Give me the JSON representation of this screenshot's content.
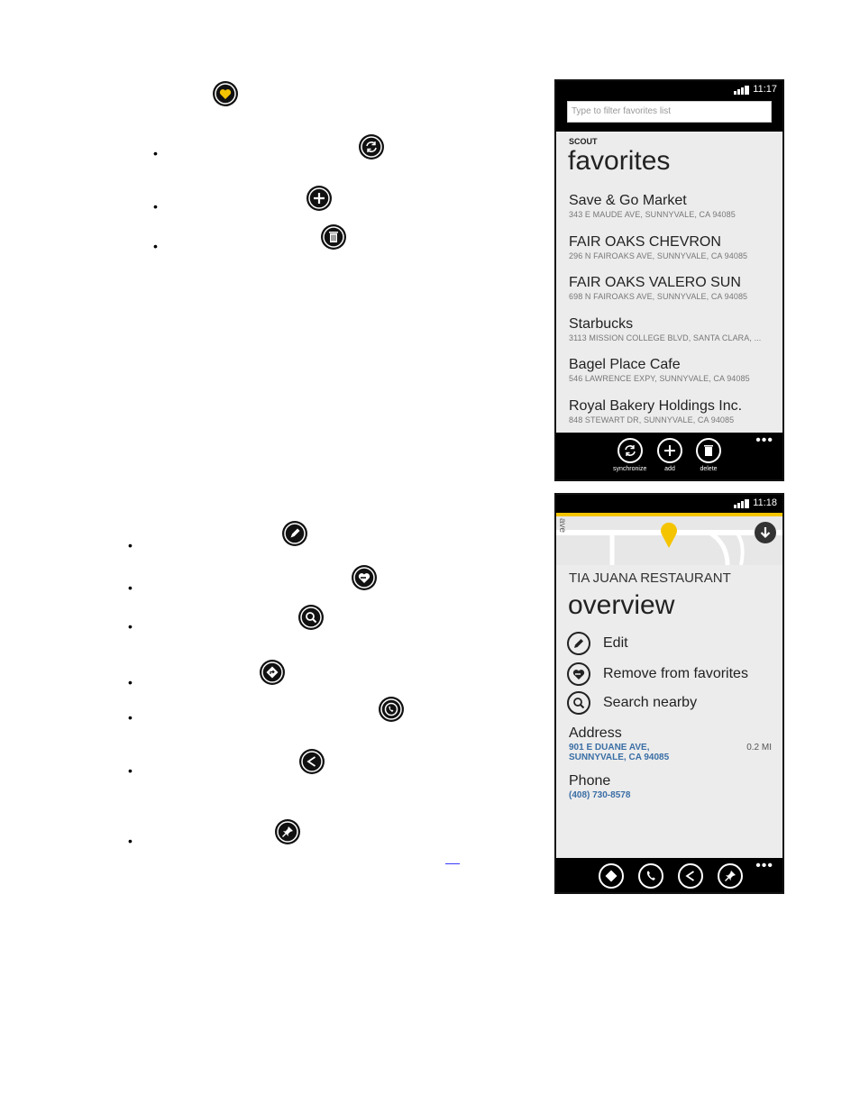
{
  "phone1": {
    "time": "11:17",
    "filter_placeholder": "Type to filter favorites list",
    "app_name": "SCOUT",
    "title": "favorites",
    "items": [
      {
        "name": "Save & Go Market",
        "addr": "343 E MAUDE AVE, SUNNYVALE, CA 94085"
      },
      {
        "name": "FAIR OAKS CHEVRON",
        "addr": "296 N FAIROAKS AVE, SUNNYVALE, CA 94085"
      },
      {
        "name": "FAIR OAKS VALERO SUN",
        "addr": "698 N FAIROAKS AVE, SUNNYVALE, CA 94085"
      },
      {
        "name": "Starbucks",
        "addr": "3113 MISSION COLLEGE BLVD, SANTA CLARA, ..."
      },
      {
        "name": "Bagel Place Cafe",
        "addr": "546 LAWRENCE EXPY, SUNNYVALE, CA 94085"
      },
      {
        "name": "Royal Bakery Holdings Inc.",
        "addr": "848 STEWART DR, SUNNYVALE, CA 94085"
      }
    ],
    "appbar": {
      "sync": "synchronize",
      "add": "add",
      "delete": "delete",
      "more": "•••"
    }
  },
  "phone2": {
    "time": "11:18",
    "map_label": "ave",
    "place": "TIA JUANA RESTAURANT",
    "title": "overview",
    "menu": {
      "edit": "Edit",
      "remove": "Remove from favorites",
      "search": "Search nearby"
    },
    "address_label": "Address",
    "address_line1": "901 E DUANE AVE,",
    "address_line2": "SUNNYVALE, CA 94085",
    "distance": "0.2 MI",
    "phone_label": "Phone",
    "phone": "(408) 730-8578",
    "more": "•••"
  },
  "colors": {
    "accent": "#f5c400",
    "link": "#3a6ea5",
    "bar": "#000000"
  }
}
